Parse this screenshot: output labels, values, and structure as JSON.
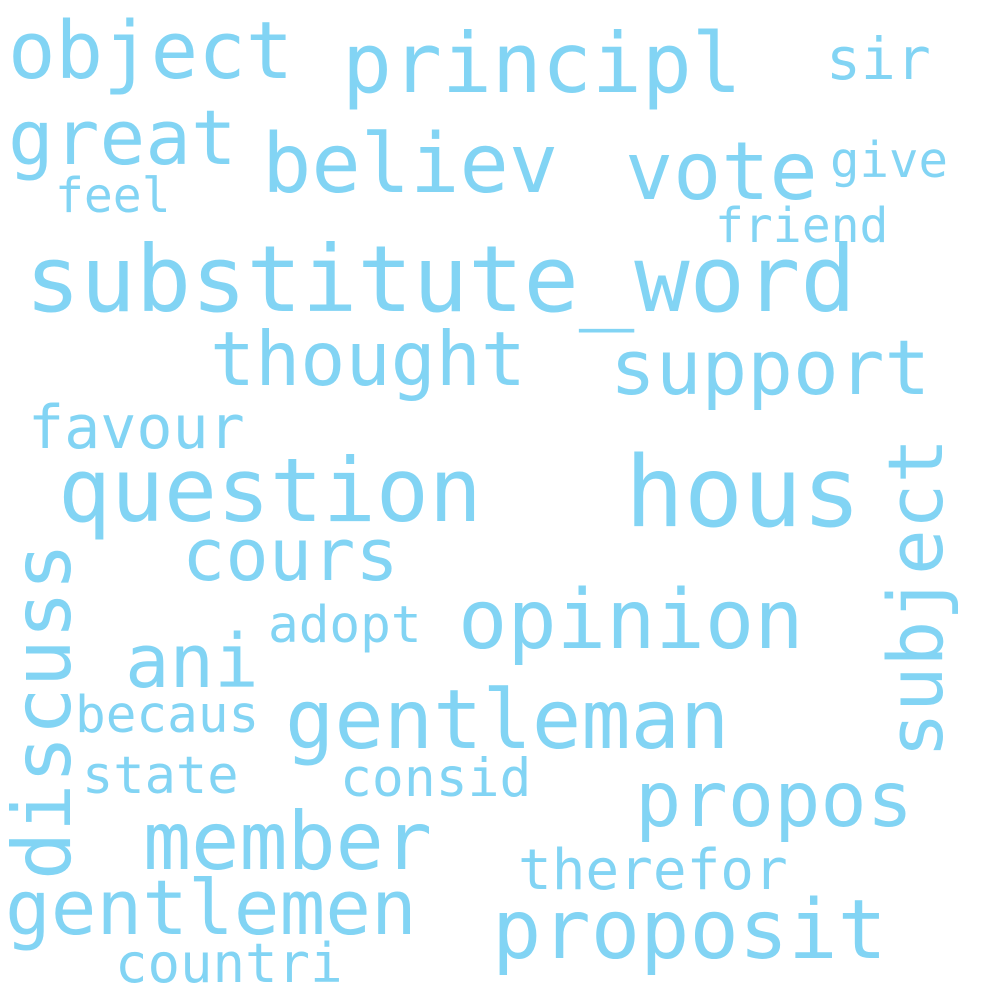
{
  "word_cloud": {
    "color": "#82d4f4",
    "words": {
      "substitute_word": "substitute_word",
      "question": "question",
      "hous": "hous",
      "opinion": "opinion",
      "gentleman": "gentleman",
      "principl": "principl",
      "object": "object",
      "believ": "believ",
      "vote": "vote",
      "great": "great",
      "thought": "thought",
      "support": "support",
      "subject": "subject",
      "cours": "cours",
      "ani": "ani",
      "member": "member",
      "propos": "propos",
      "gentlemen": "gentlemen",
      "proposit": "proposit",
      "discuss": "discuss",
      "favour": "favour",
      "sir": "sir",
      "give": "give",
      "feel": "feel",
      "friend": "friend",
      "adopt": "adopt",
      "becaus": "becaus",
      "state": "state",
      "consid": "consid",
      "therefor": "therefor",
      "countri": "countri"
    }
  }
}
